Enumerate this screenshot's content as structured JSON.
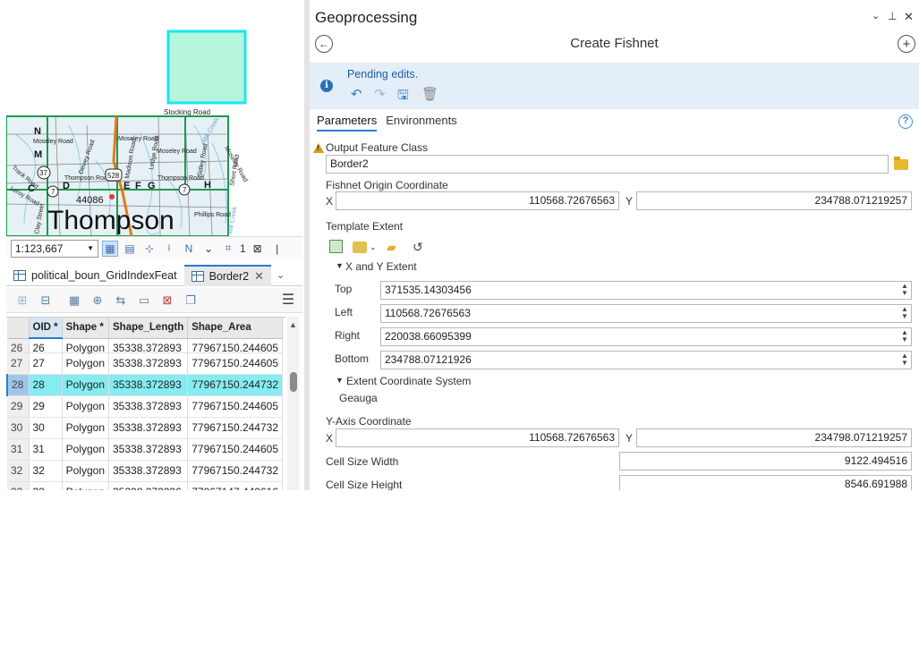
{
  "map": {
    "labels": {
      "stocking_road": "Stocking Road",
      "moseley_road_1": "Moseley Road",
      "moseley_road_2": "Moseley Road",
      "moseley_road_3": "Moseley Road",
      "moseley_road_4": "Moseley Road",
      "thompson_road_1": "Thompson Road",
      "thompson_road_2": "Thompson Road",
      "dewey_road": "Dewey Road",
      "madison_road": "Madison Road",
      "ledge_road": "Ledge Road",
      "sidley_road": "Sidley Road",
      "short_road": "Short Road",
      "track_road": "Track Road",
      "leroy_road": "Leroy Road",
      "clay_street": "Clay Street",
      "phillips_road": "Phillips Road",
      "mill_creek_1": "Mill Creek",
      "mill_creek_2": "Mill Creek",
      "route_37": "37",
      "route_7_a": "7",
      "route_7_b": "7",
      "route_528": "528",
      "route_44086": "44086",
      "grid_n": "N",
      "grid_m": "M",
      "grid_c": "C",
      "grid_d": "D",
      "grid_e": "E",
      "grid_f": "F",
      "grid_g": "G",
      "grid_h": "H",
      "town": "Thompson"
    }
  },
  "statusbar": {
    "scale": "1:123,667",
    "selected_count": "1"
  },
  "table_tabs": [
    {
      "label": "political_boun_GridIndexFeat"
    },
    {
      "label": "Border2"
    }
  ],
  "table": {
    "columns": [
      "OID *",
      "Shape *",
      "Shape_Length",
      "Shape_Area"
    ],
    "rows": [
      {
        "num": "26",
        "oid": "26",
        "shape": "Polygon",
        "length": "35338.372893",
        "area": "77967150.244605"
      },
      {
        "num": "27",
        "oid": "27",
        "shape": "Polygon",
        "length": "35338.372893",
        "area": "77967150.244605"
      },
      {
        "num": "28",
        "oid": "28",
        "shape": "Polygon",
        "length": "35338.372893",
        "area": "77967150.244732"
      },
      {
        "num": "29",
        "oid": "29",
        "shape": "Polygon",
        "length": "35338.372893",
        "area": "77967150.244605"
      },
      {
        "num": "30",
        "oid": "30",
        "shape": "Polygon",
        "length": "35338.372893",
        "area": "77967150.244732"
      },
      {
        "num": "31",
        "oid": "31",
        "shape": "Polygon",
        "length": "35338.372893",
        "area": "77967150.244605"
      },
      {
        "num": "32",
        "oid": "32",
        "shape": "Polygon",
        "length": "35338.372893",
        "area": "77967150.244732"
      },
      {
        "num": "33",
        "oid": "33",
        "shape": "Polygon",
        "length": "35338.372236",
        "area": "77967147.440616"
      }
    ]
  },
  "gp": {
    "title": "Geoprocessing",
    "tool": "Create Fishnet",
    "pending": "Pending edits.",
    "tabs": [
      "Parameters",
      "Environments"
    ],
    "output_label": "Output Feature Class",
    "output_value": "Border2",
    "origin_label": "Fishnet Origin Coordinate",
    "x_label": "X",
    "y_label": "Y",
    "origin_x": "110568.72676563",
    "origin_y": "234788.071219257",
    "template_label": "Template Extent",
    "xy_extent_label": "X and Y Extent",
    "top_label": "Top",
    "top_value": "371535.14303456",
    "left_label": "Left",
    "left_value": "110568.72676563",
    "right_label": "Right",
    "right_value": "220038.66095399",
    "bottom_label": "Bottom",
    "bottom_value": "234788.07121926",
    "extent_cs_label": "Extent Coordinate System",
    "extent_cs_value": "Geauga",
    "yaxis_label": "Y-Axis Coordinate",
    "yaxis_x": "110568.72676563",
    "yaxis_y": "234798.071219257",
    "cell_width_label": "Cell Size Width",
    "cell_width_value": "9122.494516",
    "cell_height_label": "Cell Size Height",
    "cell_height_value": "8546.691988"
  },
  "colors": {
    "accent": "#2a7bd0",
    "selected_row": "#86ecf0",
    "pending_bg": "#e3eef8",
    "grid_polygon_fill": "#b4f5dc",
    "grid_polygon_stroke": "#19e5ef"
  }
}
